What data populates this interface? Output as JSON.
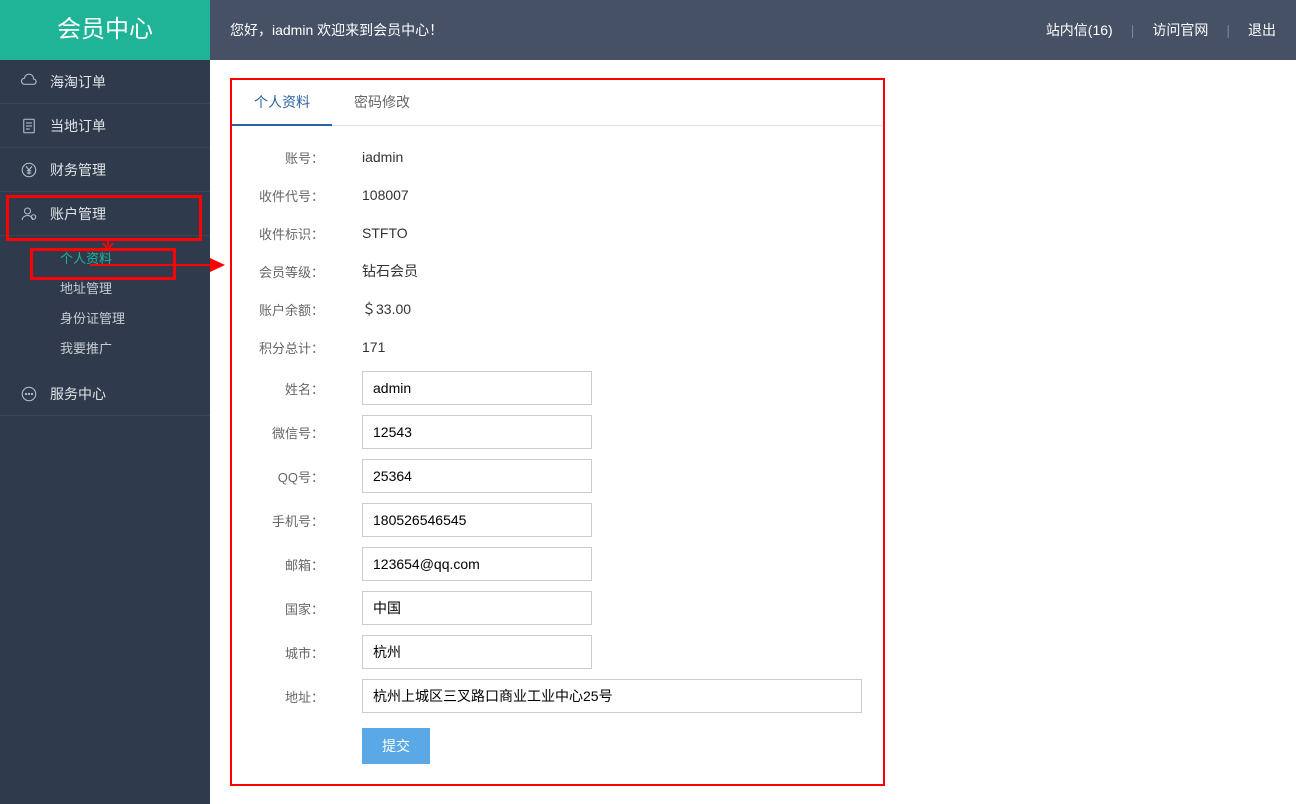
{
  "sidebar": {
    "title": "会员中心",
    "items": [
      {
        "label": "海淘订单"
      },
      {
        "label": "当地订单"
      },
      {
        "label": "财务管理"
      },
      {
        "label": "账户管理"
      },
      {
        "label": "服务中心"
      }
    ],
    "sub_items": [
      {
        "label": "个人资料",
        "active": true
      },
      {
        "label": "地址管理"
      },
      {
        "label": "身份证管理"
      },
      {
        "label": "我要推广"
      }
    ]
  },
  "topbar": {
    "greeting": "您好，iadmin  欢迎来到会员中心！",
    "mail_label": "站内信(16)",
    "site_label": "访问官网",
    "logout_label": "退出"
  },
  "tabs": {
    "profile": "个人资料",
    "password": "密码修改"
  },
  "profile": {
    "labels": {
      "account": "账号：",
      "recv_code": "收件代号：",
      "recv_tag": "收件标识：",
      "member_level": "会员等级：",
      "balance": "账户余额：",
      "points": "积分总计：",
      "name": "姓名：",
      "wechat": "微信号：",
      "qq": "QQ号：",
      "phone": "手机号：",
      "email": "邮箱：",
      "country": "国家：",
      "city": "城市：",
      "address": "地址："
    },
    "values": {
      "account": "iadmin",
      "recv_code": "108007",
      "recv_tag": "STFTO",
      "member_level": "钻石会员",
      "balance": "＄33.00",
      "points": "171",
      "name": "admin",
      "wechat": "12543",
      "qq": "25364",
      "phone": "180526546545",
      "email": "123654@qq.com",
      "country": "中国",
      "city": "杭州",
      "address": "杭州上城区三叉路口商业工业中心25号"
    },
    "submit_label": "提交"
  }
}
